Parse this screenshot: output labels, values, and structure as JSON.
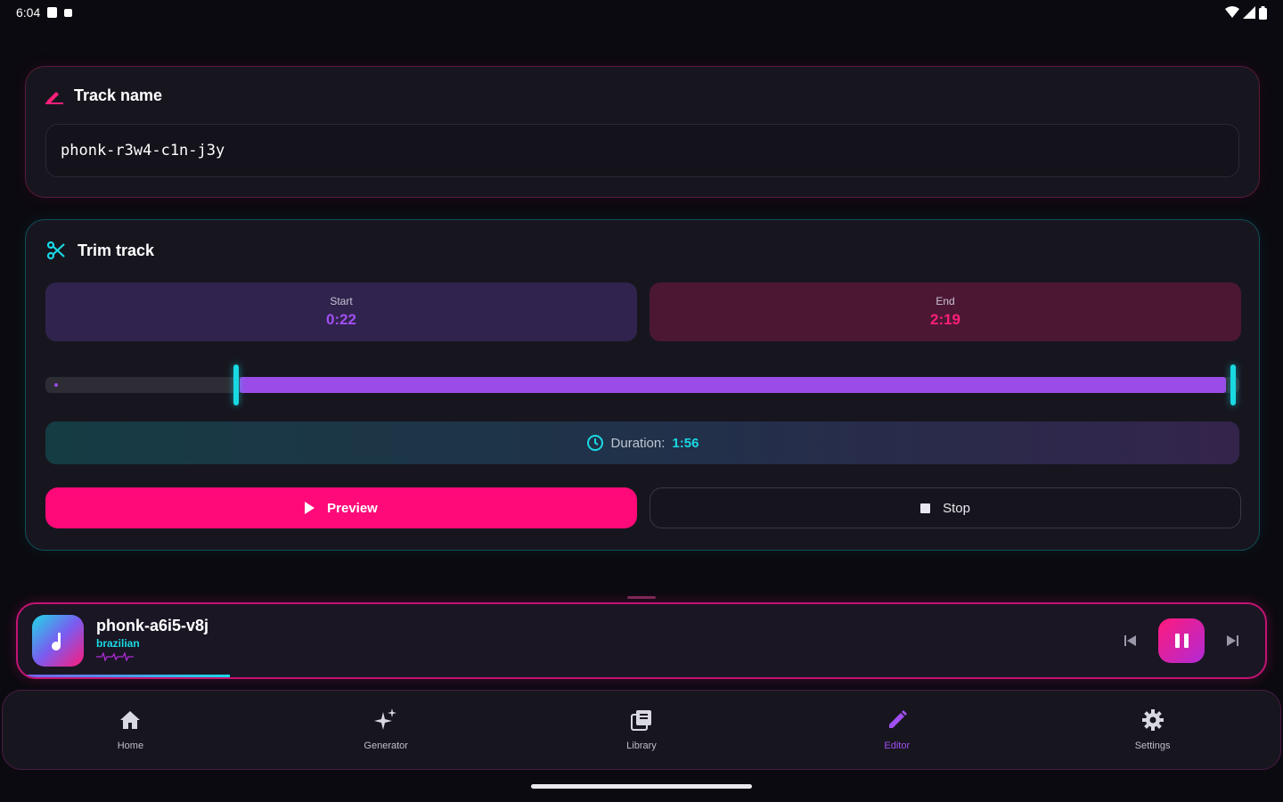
{
  "status_bar": {
    "time": "6:04"
  },
  "track_name_card": {
    "title": "Track name",
    "value": "phonk-r3w4-c1n-j3y"
  },
  "trim_card": {
    "title": "Trim track",
    "start": {
      "label": "Start",
      "value": "0:22"
    },
    "end": {
      "label": "End",
      "value": "2:19"
    },
    "range": {
      "start_fraction": 0.16,
      "end_fraction": 0.995
    },
    "duration": {
      "label": "Duration:",
      "value": "1:56"
    },
    "preview_label": "Preview",
    "stop_label": "Stop"
  },
  "mini_player": {
    "title": "phonk-a6i5-v8j",
    "genre": "brazilian",
    "progress_fraction": 0.17
  },
  "nav": {
    "items": [
      {
        "label": "Home",
        "icon": "home-icon"
      },
      {
        "label": "Generator",
        "icon": "sparkles-icon"
      },
      {
        "label": "Library",
        "icon": "library-icon"
      },
      {
        "label": "Editor",
        "icon": "pencil-icon"
      },
      {
        "label": "Settings",
        "icon": "gear-icon"
      }
    ],
    "active": "Editor"
  },
  "colors": {
    "accent_pink": "#ff0a78",
    "accent_purple": "#a14ff0",
    "accent_cyan": "#19d9e3"
  }
}
